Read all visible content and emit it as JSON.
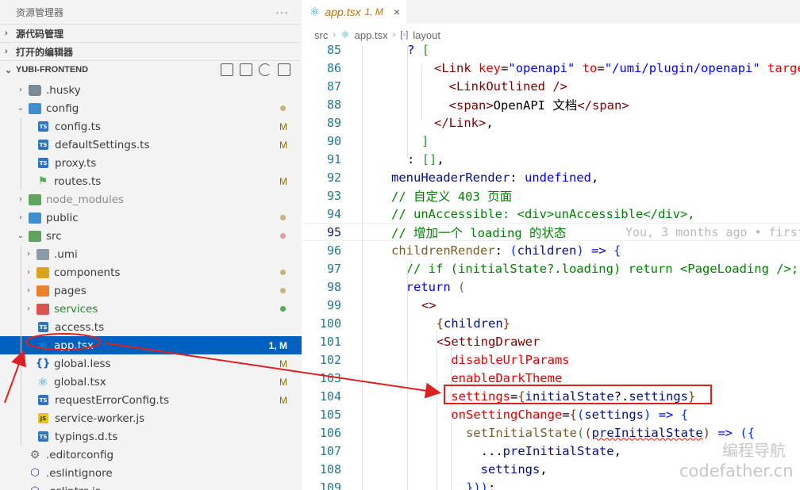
{
  "explorer": {
    "title": "资源管理器",
    "more": "···",
    "sections": {
      "source_control": "源代码管理",
      "open_editors": "打开的编辑器",
      "project": "YUBI-FRONTEND"
    },
    "tree": [
      {
        "label": ".husky",
        "level": 0,
        "chev": "›",
        "icon": "folder",
        "icon_name": "folder-icon"
      },
      {
        "label": "config",
        "level": 0,
        "chev": "⌄",
        "icon": "folder-blue",
        "icon_name": "config-folder-icon",
        "dot": "#c9b27a"
      },
      {
        "label": "config.ts",
        "level": 1,
        "icon": "ts",
        "icon_name": "typescript-icon",
        "badge": "M"
      },
      {
        "label": "defaultSettings.ts",
        "level": 1,
        "icon": "ts",
        "icon_name": "typescript-icon",
        "badge": "M"
      },
      {
        "label": "proxy.ts",
        "level": 1,
        "icon": "ts",
        "icon_name": "typescript-icon"
      },
      {
        "label": "routes.ts",
        "level": 1,
        "icon": "route",
        "icon_name": "routes-icon",
        "badge": "M"
      },
      {
        "label": "node_modules",
        "level": 0,
        "chev": "›",
        "icon": "folder-green",
        "icon_name": "node-modules-folder-icon",
        "dim": true
      },
      {
        "label": "public",
        "level": 0,
        "chev": "›",
        "icon": "folder-blue",
        "icon_name": "public-folder-icon",
        "dot": "#c9b27a"
      },
      {
        "label": "src",
        "level": 0,
        "chev": "⌄",
        "icon": "folder-green",
        "icon_name": "src-folder-icon",
        "dot": "#e0a0a0"
      },
      {
        "label": ".umi",
        "level": 1,
        "chev": "›",
        "icon": "folder-grey",
        "icon_name": "umi-folder-icon"
      },
      {
        "label": "components",
        "level": 1,
        "chev": "›",
        "icon": "folder-gold",
        "icon_name": "components-folder-icon",
        "dot": "#c9b27a"
      },
      {
        "label": "pages",
        "level": 1,
        "chev": "›",
        "icon": "folder-orange",
        "icon_name": "pages-folder-icon",
        "dot": "#c9b27a"
      },
      {
        "label": "services",
        "level": 1,
        "chev": "›",
        "icon": "folder-red",
        "icon_name": "services-folder-icon",
        "dot": "#4caf50",
        "green": true
      },
      {
        "label": "access.ts",
        "level": 1,
        "icon": "ts",
        "icon_name": "typescript-icon"
      },
      {
        "label": "app.tsx",
        "level": 1,
        "icon": "react",
        "icon_name": "react-icon",
        "badge": "1, M",
        "selected": true
      },
      {
        "label": "global.less",
        "level": 1,
        "icon": "less",
        "icon_name": "less-icon",
        "badge": "M"
      },
      {
        "label": "global.tsx",
        "level": 1,
        "icon": "react",
        "icon_name": "react-icon",
        "badge": "M"
      },
      {
        "label": "requestErrorConfig.ts",
        "level": 1,
        "icon": "ts",
        "icon_name": "typescript-icon",
        "badge": "M"
      },
      {
        "label": "service-worker.js",
        "level": 1,
        "icon": "js",
        "icon_name": "javascript-icon"
      },
      {
        "label": "typings.d.ts",
        "level": 1,
        "icon": "ts",
        "icon_name": "typescript-icon"
      },
      {
        "label": ".editorconfig",
        "level": 0,
        "icon": "gear",
        "icon_name": "editorconfig-icon"
      },
      {
        "label": ".eslintignore",
        "level": 0,
        "icon": "eslint",
        "icon_name": "eslint-icon"
      },
      {
        "label": ".eslintrc.js",
        "level": 0,
        "icon": "eslint",
        "icon_name": "eslint-icon"
      }
    ]
  },
  "editor": {
    "tab": {
      "filename": "app.tsx",
      "status": "1, M",
      "close": "×"
    },
    "breadcrumb": {
      "folder": "src",
      "file": "app.tsx",
      "symbol": "layout"
    },
    "blame": "You, 3 months ago • first",
    "lines": [
      {
        "n": "85",
        "html": "<span class=\"c-kw\">?</span> <span class=\"c-br\">[</span>"
      },
      {
        "n": "86",
        "html": "<span class=\"c-tag\">&lt;Link</span> <span class=\"c-attr\">key</span>=<span class=\"c-str\">\"openapi\"</span> <span class=\"c-attr\">to</span>=<span class=\"c-str\">\"/umi/plugin/openapi\"</span> <span class=\"c-attr\">target</span>"
      },
      {
        "n": "87",
        "html": "  <span class=\"c-tag\">&lt;LinkOutlined /&gt;</span>"
      },
      {
        "n": "88",
        "html": "  <span class=\"c-tag\">&lt;span&gt;</span>OpenAPI 文档<span class=\"c-tag\">&lt;/span&gt;</span>"
      },
      {
        "n": "89",
        "html": "<span class=\"c-tag\">&lt;/Link&gt;</span>,"
      },
      {
        "n": "90",
        "html": "<span class=\"c-br\">]</span>"
      },
      {
        "n": "91",
        "html": ": <span class=\"c-br\">[]</span>,"
      },
      {
        "n": "92",
        "html": "<span class=\"c-var\">menuHeaderRender</span>: <span class=\"c-kw\">undefined</span>,"
      },
      {
        "n": "93",
        "html": "<span class=\"c-cm\">// 自定义 403 页面</span>"
      },
      {
        "n": "94",
        "html": "<span class=\"c-cm\">// unAccessible: &lt;div&gt;unAccessible&lt;/div&gt;,</span>"
      },
      {
        "n": "95",
        "html": "<span class=\"c-cm\">// 增加一个 loading 的状态</span>"
      },
      {
        "n": "96",
        "html": "<span class=\"c-fn\">childrenRender</span>: <span class=\"c-br3\">(</span><span class=\"c-var\">children</span><span class=\"c-br3\">)</span> <span class=\"c-kw\">=&gt;</span> <span class=\"c-br3\">{</span>"
      },
      {
        "n": "97",
        "html": "  <span class=\"c-cm\">// if (initialState?.loading) return &lt;PageLoading /&gt;;</span>"
      },
      {
        "n": "98",
        "html": "  <span class=\"c-kw\">return</span> <span class=\"c-br\">(</span>"
      },
      {
        "n": "99",
        "html": "<span class=\"c-tag\">&lt;&gt;</span>"
      },
      {
        "n": "100",
        "html": "  <span class=\"c-br2\">{</span><span class=\"c-var\">children</span><span class=\"c-br2\">}</span>"
      },
      {
        "n": "101",
        "html": "  <span class=\"c-tag\">&lt;SettingDrawer</span>"
      },
      {
        "n": "102",
        "html": "    <span class=\"c-attr\">disableUrlParams</span>"
      },
      {
        "n": "103",
        "html": "    <span class=\"c-attr\">enableDarkTheme</span>"
      },
      {
        "n": "104",
        "html": "    <span class=\"c-attr\">settings</span>=<span class=\"c-br2\">{</span><span class=\"c-var\">initialState</span>?.<span class=\"c-var\">settings</span><span class=\"c-br2\">}</span>"
      },
      {
        "n": "105",
        "html": "    <span class=\"c-attr\">onSettingChange</span>=<span class=\"c-br2\">{</span><span class=\"c-br3\">(</span><span class=\"c-var\">settings</span><span class=\"c-br3\">)</span> <span class=\"c-kw\">=&gt;</span> <span class=\"c-br3\">{</span>"
      },
      {
        "n": "106",
        "html": "      <span class=\"c-fn\">setInitialState</span><span class=\"c-br\">(</span><span class=\"c-br2\">(</span><span class=\"c-var squiggle\">preInitialState</span><span class=\"c-br2\">)</span> <span class=\"c-kw\">=&gt;</span> <span class=\"c-br3\">({</span>"
      },
      {
        "n": "107",
        "html": "        ...<span class=\"c-var\">preInitialState</span>,"
      },
      {
        "n": "108",
        "html": "        <span class=\"c-var\">settings</span>,"
      },
      {
        "n": "109",
        "html": "      <span class=\"c-br3\">}))</span>;"
      }
    ],
    "current_line": "95"
  },
  "watermark": {
    "line1": "编程导航",
    "line2": "codefather.cn"
  },
  "colors": {
    "selection": "#0060c0",
    "annotation": "#e02020",
    "modified": "#8a6d00"
  }
}
